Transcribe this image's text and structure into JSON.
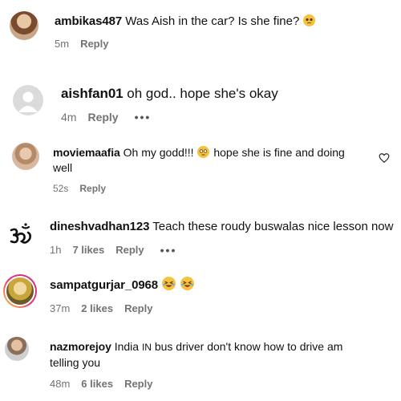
{
  "comments": [
    {
      "username": "ambikas487",
      "text": "Was Aish in the car? Is she fine?",
      "time": "5m",
      "reply": "Reply",
      "avatar_icon": "avatar-woman-photo",
      "emoji": "pleading-face"
    },
    {
      "username": "aishfan01",
      "text": "oh god.. hope she's okay",
      "time": "4m",
      "reply": "Reply",
      "more": "•••",
      "avatar_icon": "default-avatar-icon"
    },
    {
      "username": "moviemaafia",
      "text_before": "Oh my godd!!!",
      "text_after": "hope she is fine and doing",
      "text_line2": "well",
      "time": "52s",
      "reply": "Reply",
      "avatar_icon": "avatar-woman-photo",
      "emoji": "flushed-face",
      "like_icon": "heart-outline-icon"
    },
    {
      "username": "dineshvadhan123",
      "text": "Teach these roudy buswalas nice lesson now",
      "time": "1h",
      "likes": "7 likes",
      "reply": "Reply",
      "more": "•••",
      "avatar_icon": "om-symbol-icon"
    },
    {
      "username": "sampatgurjar_0968",
      "time": "37m",
      "likes": "2 likes",
      "reply": "Reply",
      "avatar_icon": "avatar-story-ring",
      "emoji": "laughing-face"
    },
    {
      "username": "nazmorejoy",
      "text_before": "India",
      "text_tag": "IN",
      "text_after": "bus driver don't know how to drive am",
      "text_line2": "telling you",
      "time": "48m",
      "likes": "6 likes",
      "reply": "Reply",
      "avatar_icon": "avatar-woman-photo"
    }
  ],
  "colors": {
    "meta_text": "#737373",
    "story_ring_start": "#f9ce34",
    "story_ring_end": "#c13584",
    "emoji_yellow": "#f7c23b"
  }
}
